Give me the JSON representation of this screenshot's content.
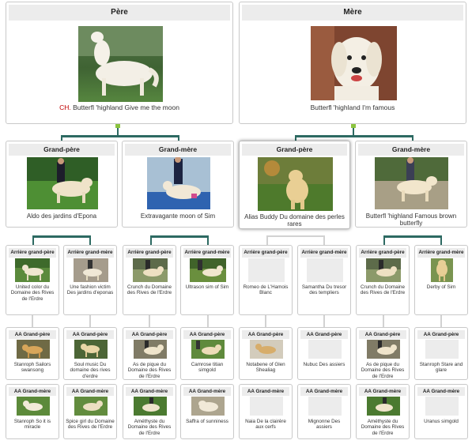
{
  "pere": {
    "label": "Père",
    "prefix": "CH.",
    "name": " Butterfl 'highland Give me the moon"
  },
  "mere": {
    "label": "Mère",
    "name": "Butterfl 'highland I'm famous"
  },
  "grandparents": [
    {
      "label": "Grand-père",
      "name": "Aldo des jardins d'Epona"
    },
    {
      "label": "Grand-mère",
      "name": "Extravagante moon of Sim"
    },
    {
      "label": "Grand-père",
      "name": "Alias Buddy Du domaine des perles rares"
    },
    {
      "label": "Grand-mère",
      "name": "Butterfl 'highland Famous brown butterfly"
    }
  ],
  "great_grandparents": [
    {
      "label": "Arrière grand-père",
      "name": "United color du Domaine des Rives de l'Erdre"
    },
    {
      "label": "Arrière grand-mère",
      "name": "Une fashion victim Des jardins d'eponas"
    },
    {
      "label": "Arrière grand-père",
      "name": "Crunch du Domaine des Rives de l'Erdre"
    },
    {
      "label": "Arrière grand-mère",
      "name": "Ultrason sim of Sim"
    },
    {
      "label": "Arrière grand-père",
      "name": "Romeo de L'Hamois Blanc"
    },
    {
      "label": "Arrière grand-mère",
      "name": "Samantha Du tresor des templiers"
    },
    {
      "label": "Arrière grand-père",
      "name": "Crunch du Domaine des Rives de l'Erdre"
    },
    {
      "label": "Arrière grand-mère",
      "name": "Derby of Sim"
    }
  ],
  "aa_grandpere": [
    {
      "label": "AA Grand-père",
      "name": "Stanroph Sailors swansong"
    },
    {
      "label": "AA Grand-père",
      "name": "Soul music Du domaine des rives d'erdre"
    },
    {
      "label": "AA Grand-père",
      "name": "As de pique du Domaine des Rives de l'Erdre"
    },
    {
      "label": "AA Grand-père",
      "name": "Camrose titian simgold"
    },
    {
      "label": "AA Grand-père",
      "name": "Notabene of Glen Shealiag"
    },
    {
      "label": "AA Grand-père",
      "name": "Nubuc Des assiers"
    },
    {
      "label": "AA Grand-père",
      "name": "As de pique du Domaine des Rives de l'Erdre"
    },
    {
      "label": "AA Grand-père",
      "name": "Stanroph Stare and glare"
    }
  ],
  "aa_grandmere": [
    {
      "label": "AA Grand-mère",
      "name": "Stanroph So it is miracle"
    },
    {
      "label": "AA Grand-mère",
      "name": "Spice girl du Domaine des Rives de l'Erdre"
    },
    {
      "label": "AA Grand-mère",
      "name": "Améthyste du Domaine des Rives de l'Erdre"
    },
    {
      "label": "AA Grand-mère",
      "name": "Saffra of sunniness"
    },
    {
      "label": "AA Grand-mère",
      "name": "Naia De la clairère aux cerfs"
    },
    {
      "label": "AA Grand-mère",
      "name": "Mignonne Des assiers"
    },
    {
      "label": "AA Grand-mère",
      "name": "Améthyste du Domaine des Rives de l'Erdre"
    },
    {
      "label": "AA Grand-mère",
      "name": "Uranus simgold"
    }
  ]
}
